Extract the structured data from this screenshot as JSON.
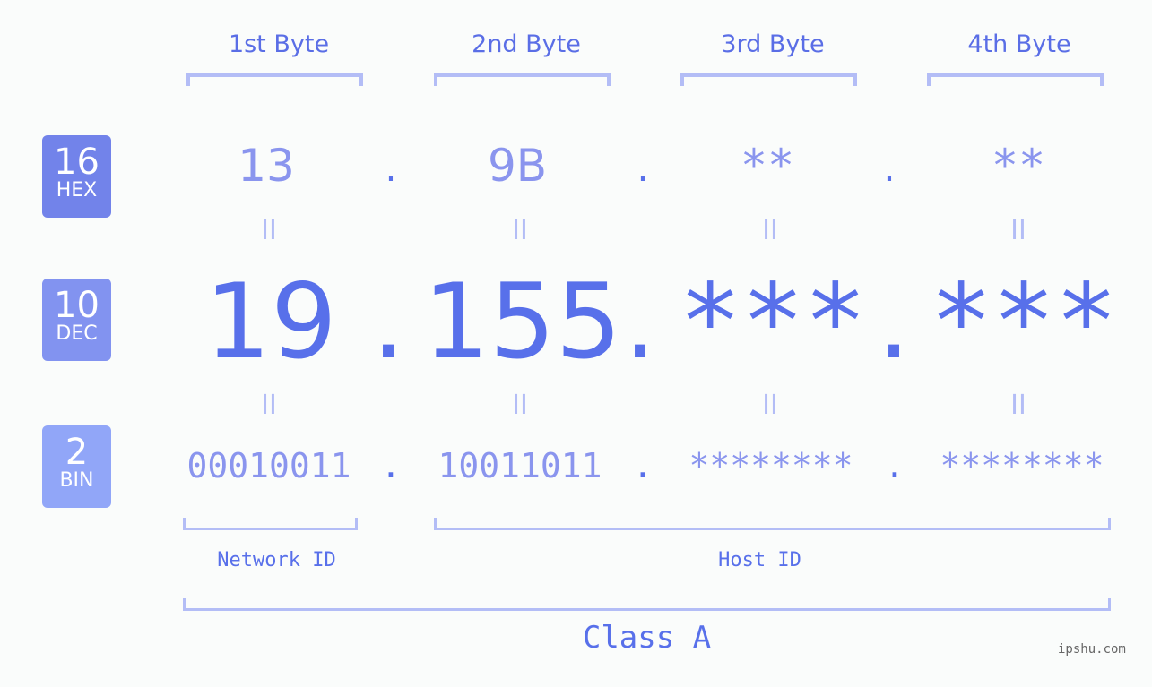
{
  "bytes": [
    {
      "label": "1st Byte",
      "hex": "13",
      "dec": "19",
      "bin": "00010011"
    },
    {
      "label": "2nd Byte",
      "hex": "9B",
      "dec": "155",
      "bin": "10011011"
    },
    {
      "label": "3rd Byte",
      "hex": "**",
      "dec": "***",
      "bin": "********"
    },
    {
      "label": "4th Byte",
      "hex": "**",
      "dec": "***",
      "bin": "********"
    }
  ],
  "bases": [
    {
      "num": "16",
      "name": "HEX",
      "color": "#7283ea"
    },
    {
      "num": "10",
      "name": "DEC",
      "color": "#8293f0"
    },
    {
      "num": "2",
      "name": "BIN",
      "color": "#91a6f8"
    }
  ],
  "separator": ".",
  "equals": "II",
  "network_id_label": "Network ID",
  "host_id_label": "Host ID",
  "class_label": "Class A",
  "watermark": "ipshu.com",
  "colors": {
    "primary": "#5870ea",
    "light": "#8a95ee",
    "bracket": "#b3bdf6"
  }
}
